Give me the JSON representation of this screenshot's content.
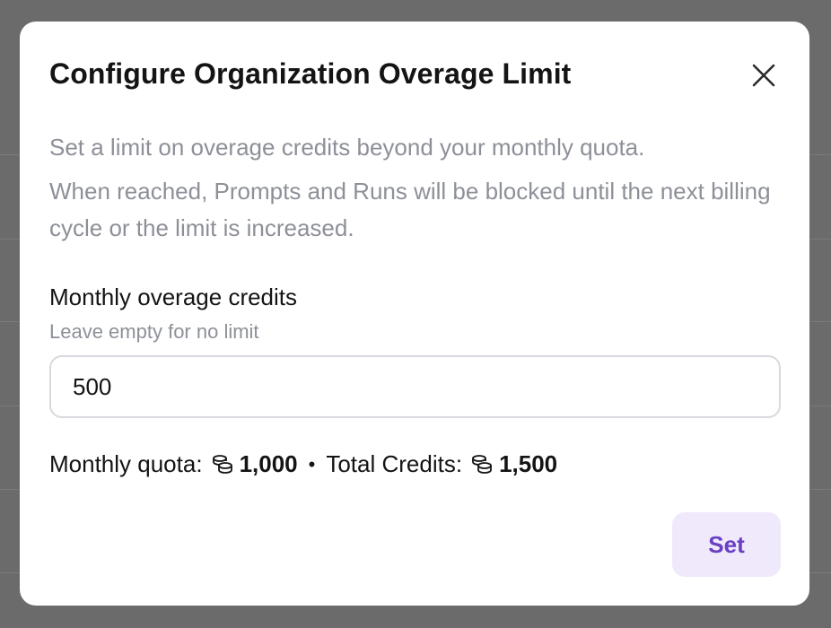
{
  "dialog": {
    "title": "Configure Organization Overage Limit",
    "description_line1": "Set a limit on overage credits beyond your monthly quota.",
    "description_line2": "When reached, Prompts and Runs will be blocked until the next billing cycle or the limit is increased."
  },
  "field": {
    "label": "Monthly overage credits",
    "hint": "Leave empty for no limit",
    "value": "500"
  },
  "summary": {
    "monthly_quota_label": "Monthly quota:",
    "monthly_quota_value": "1,000",
    "separator": "•",
    "total_credits_label": "Total Credits:",
    "total_credits_value": "1,500",
    "icon": "coins-icon"
  },
  "actions": {
    "set_label": "Set"
  },
  "colors": {
    "accent": "#6a3fc2",
    "accent_bg": "#efe9fb",
    "muted_text": "#8d9098",
    "backdrop": "#6b6b6b"
  }
}
